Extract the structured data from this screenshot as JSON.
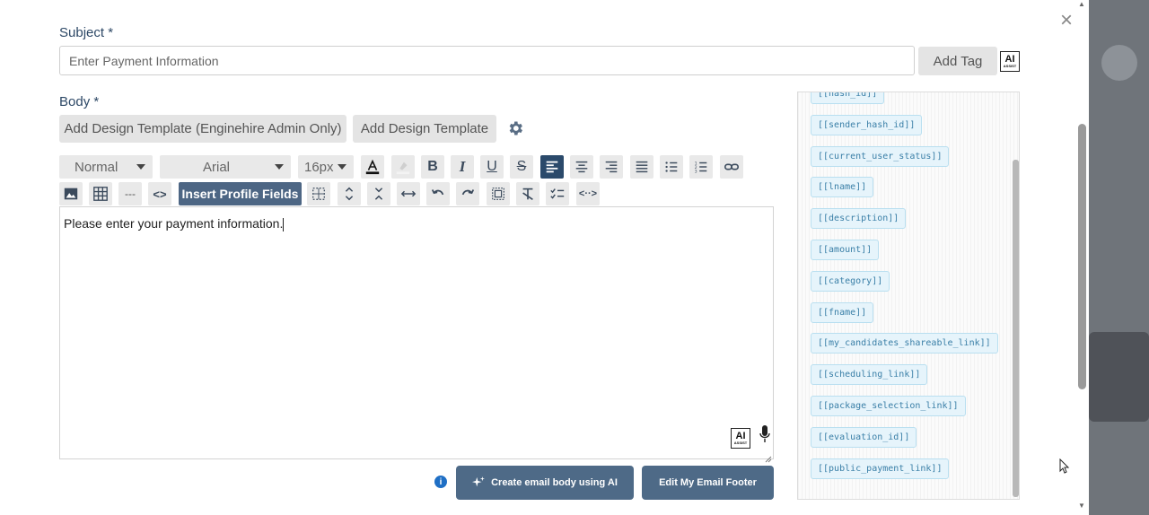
{
  "subject": {
    "label": "Subject",
    "required_mark": "*",
    "placeholder": "Enter Payment Information",
    "add_tag_label": "Add Tag"
  },
  "ai_assist": {
    "title": "AI",
    "sub": "ASSIST"
  },
  "body": {
    "label": "Body",
    "required_mark": "*",
    "add_design_admin_label": "Add Design Template (Enginehire Admin Only)",
    "add_design_label": "Add Design Template"
  },
  "toolbar": {
    "style_value": "Normal",
    "font_value": "Arial",
    "size_value": "16px",
    "insert_profile_fields": "Insert Profile Fields",
    "hr_label": "---",
    "code_label": "<>",
    "embed_label": "<··>"
  },
  "editor": {
    "content": "Please enter your payment information."
  },
  "actions": {
    "create_ai_label": "Create email body using AI",
    "edit_footer_label": "Edit My Email Footer",
    "info_glyph": "i"
  },
  "tags": [
    "[[hash_id]]",
    "[[sender_hash_id]]",
    "[[current_user_status]]",
    "[[lname]]",
    "[[description]]",
    "[[amount]]",
    "[[category]]",
    "[[fname]]",
    "[[my_candidates_shareable_link]]",
    "[[scheduling_link]]",
    "[[package_selection_link]]",
    "[[evaluation_id]]",
    "[[public_payment_link]]"
  ],
  "icons": {
    "close": "close-icon",
    "gear": "gear-icon",
    "mic": "microphone-icon"
  },
  "colors": {
    "accent": "#2b4a6b",
    "button_dark": "#4e6a87",
    "label": "#2d4866",
    "tag_bg": "#e6f4fb",
    "tag_text": "#3a7fa7"
  }
}
